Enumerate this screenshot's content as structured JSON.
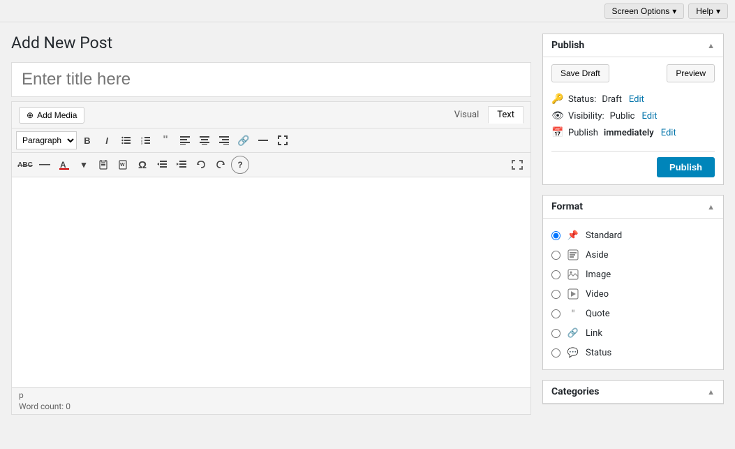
{
  "topbar": {
    "screen_options": "Screen Options",
    "help": "Help"
  },
  "page": {
    "title": "Add New Post"
  },
  "editor": {
    "title_placeholder": "Enter title here",
    "add_media_label": "Add Media",
    "tab_visual": "Visual",
    "tab_text": "Text",
    "toolbar": {
      "paragraph_select": "Paragraph",
      "buttons": [
        "B",
        "I",
        "≡",
        "≡",
        "❝",
        "≡",
        "≡",
        "≡",
        "🔗",
        "≡",
        "⊞"
      ]
    },
    "word_count_label": "Word count:",
    "word_count": "0",
    "p_indicator": "p"
  },
  "publish_panel": {
    "title": "Publish",
    "save_draft": "Save Draft",
    "preview": "Preview",
    "status_label": "Status:",
    "status_value": "Draft",
    "status_edit": "Edit",
    "visibility_label": "Visibility:",
    "visibility_value": "Public",
    "visibility_edit": "Edit",
    "publish_label": "Publish",
    "publish_time": "immediately",
    "publish_time_edit": "Edit",
    "publish_btn": "Publish"
  },
  "format_panel": {
    "title": "Format",
    "formats": [
      {
        "id": "standard",
        "label": "Standard",
        "icon": "📌",
        "checked": true
      },
      {
        "id": "aside",
        "label": "Aside",
        "icon": "▦",
        "checked": false
      },
      {
        "id": "image",
        "label": "Image",
        "icon": "▦",
        "checked": false
      },
      {
        "id": "video",
        "label": "Video",
        "icon": "▦",
        "checked": false
      },
      {
        "id": "quote",
        "label": "Quote",
        "icon": "❝",
        "checked": false
      },
      {
        "id": "link",
        "label": "Link",
        "icon": "🔗",
        "checked": false
      },
      {
        "id": "status",
        "label": "Status",
        "icon": "💬",
        "checked": false
      }
    ]
  },
  "categories_panel": {
    "title": "Categories"
  }
}
